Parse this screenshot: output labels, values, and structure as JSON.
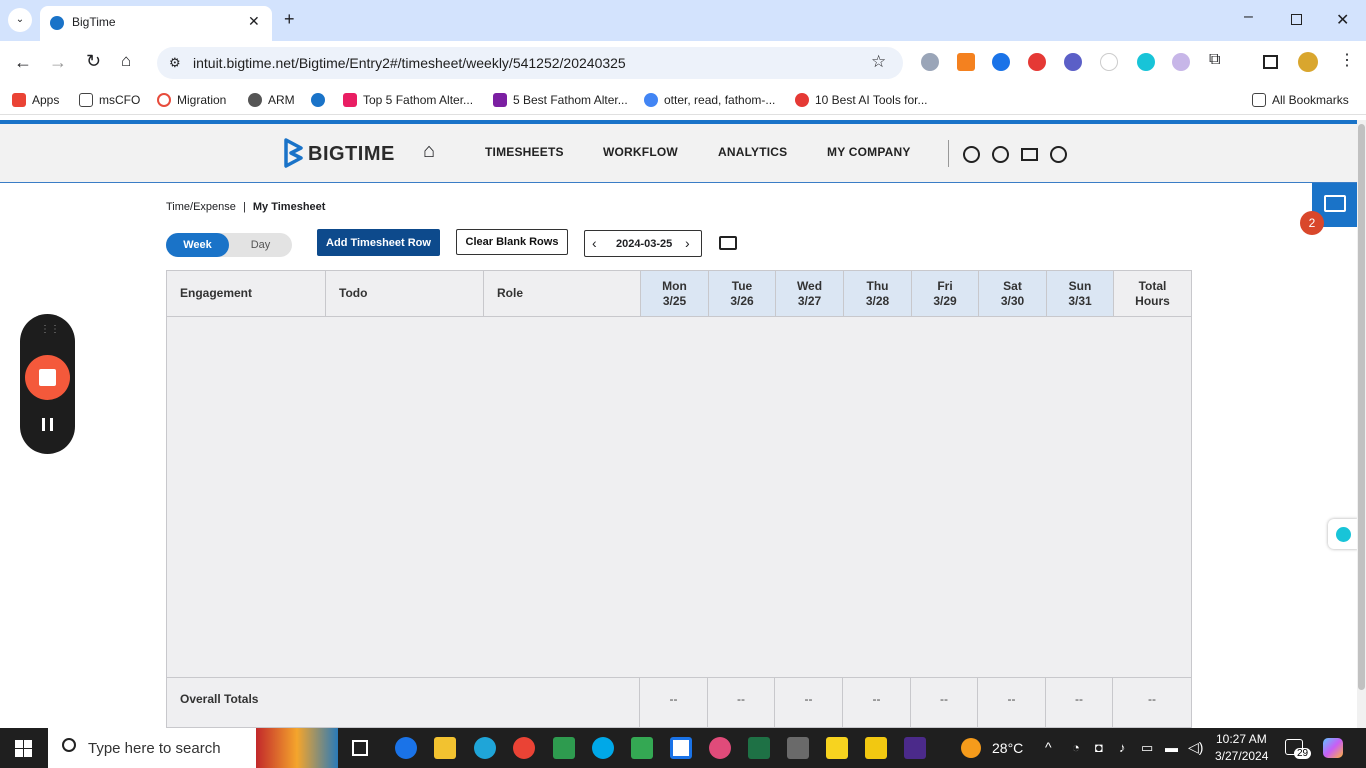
{
  "browser": {
    "tab_title": "BigTime",
    "url": "intuit.bigtime.net/Bigtime/Entry2#/timesheet/weekly/541252/20240325",
    "bookmarks": [
      {
        "label": "Apps",
        "color": "#ea4335"
      },
      {
        "label": "msCFO",
        "color": "#444444"
      },
      {
        "label": "Migration",
        "color": "#e74c3c"
      },
      {
        "label": "ARM",
        "color": "#555555"
      },
      {
        "label": "",
        "color": "#1a73c8"
      },
      {
        "label": "Top 5 Fathom Alter...",
        "color": "#e91e63"
      },
      {
        "label": "5 Best Fathom Alter...",
        "color": "#7b1fa2"
      },
      {
        "label": "otter, read, fathom-...",
        "color": "#4285f4"
      },
      {
        "label": "10 Best AI Tools for...",
        "color": "#e53935"
      }
    ],
    "all_bookmarks": "All Bookmarks"
  },
  "nav": {
    "brand": "BIGTIME",
    "links": [
      "TIMESHEETS",
      "WORKFLOW",
      "ANALYTICS",
      "MY COMPANY"
    ]
  },
  "breadcrumb": {
    "parent": "Time/Expense",
    "separator": "|",
    "current": "My Timesheet"
  },
  "controls": {
    "week": "Week",
    "day": "Day",
    "add_row": "Add Timesheet Row",
    "clear_rows": "Clear Blank Rows",
    "date": "2024-03-25"
  },
  "notification_count": "2",
  "grid": {
    "col_engagement": "Engagement",
    "col_todo": "Todo",
    "col_role": "Role",
    "days": [
      {
        "name": "Mon",
        "date": "3/25"
      },
      {
        "name": "Tue",
        "date": "3/26"
      },
      {
        "name": "Wed",
        "date": "3/27"
      },
      {
        "name": "Thu",
        "date": "3/28"
      },
      {
        "name": "Fri",
        "date": "3/29"
      },
      {
        "name": "Sat",
        "date": "3/30"
      },
      {
        "name": "Sun",
        "date": "3/31"
      }
    ],
    "total_hours_1": "Total",
    "total_hours_2": "Hours",
    "overall_totals": "Overall Totals",
    "totals": [
      "--",
      "--",
      "--",
      "--",
      "--",
      "--",
      "--",
      "--"
    ]
  },
  "taskbar": {
    "search_placeholder": "Type here to search",
    "temperature": "28°C",
    "time": "10:27 AM",
    "date": "3/27/2024",
    "badge": "29"
  },
  "colors": {
    "accent": "#1a73c8",
    "primary_button": "#0d4a8c",
    "record_red": "#f4593b"
  }
}
